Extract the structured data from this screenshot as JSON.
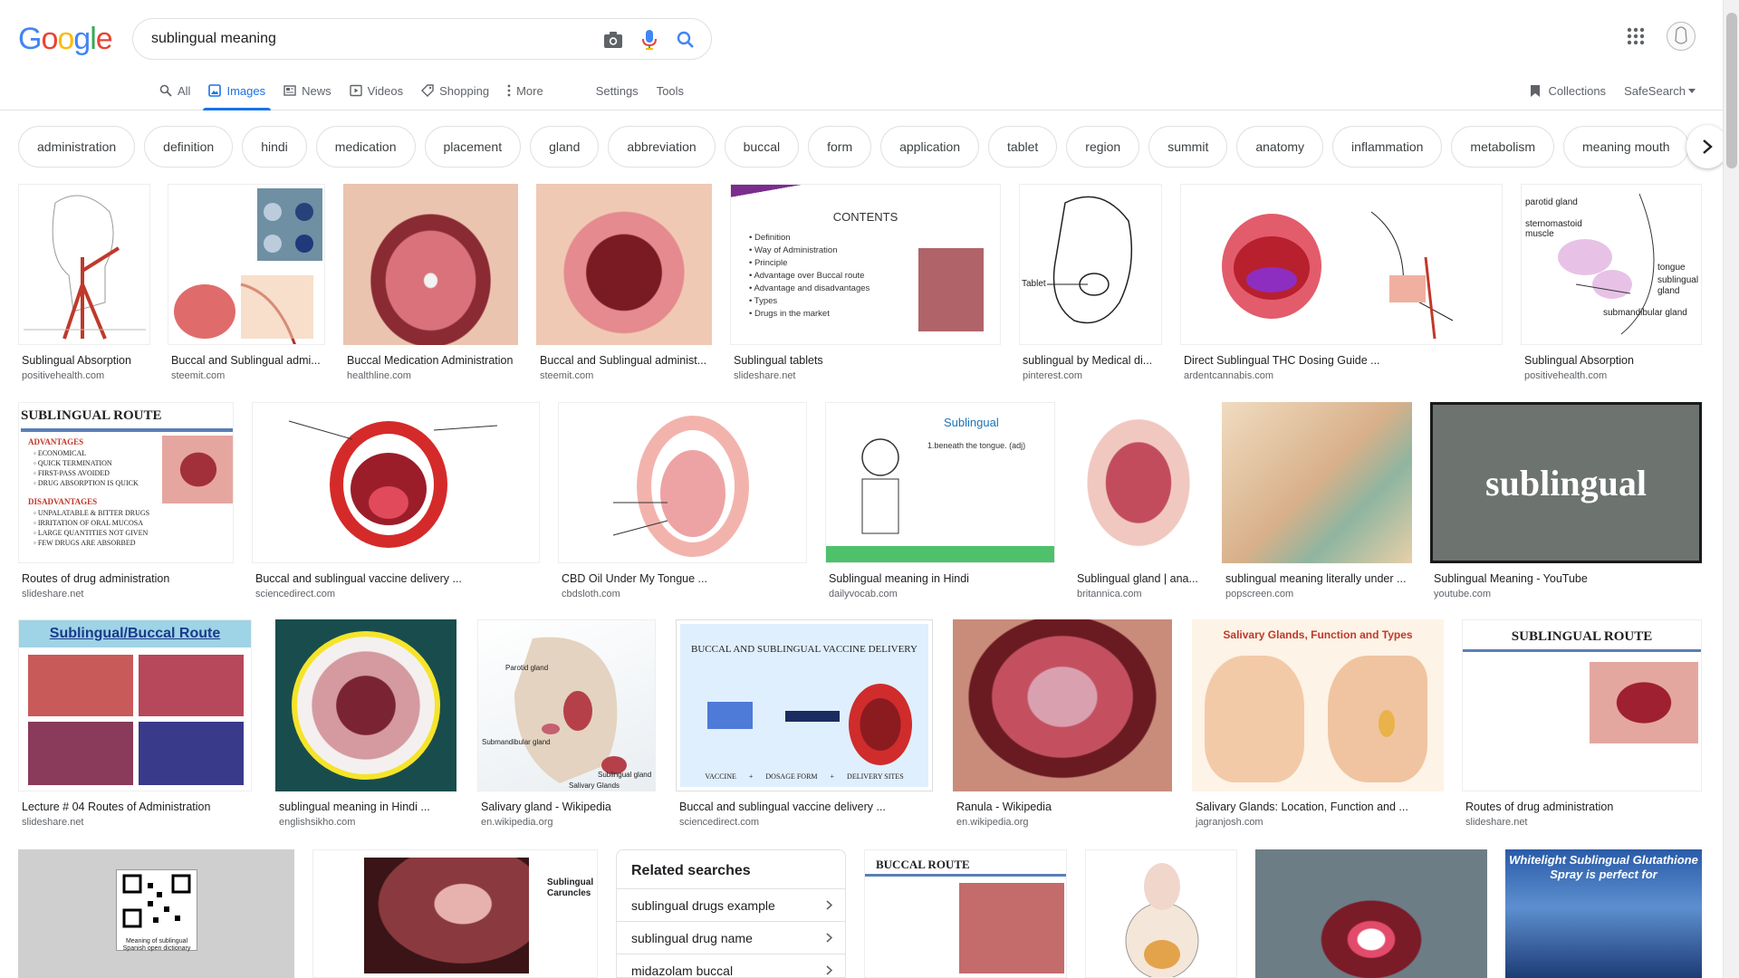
{
  "logo": {
    "letters": [
      "G",
      "o",
      "o",
      "g",
      "l",
      "e"
    ],
    "colors": [
      "#4285F4",
      "#EA4335",
      "#FBBC05",
      "#4285F4",
      "#34A853",
      "#EA4335"
    ]
  },
  "search": {
    "value": "sublingual meaning",
    "icons": [
      "camera-icon",
      "mic-icon",
      "search-icon"
    ]
  },
  "tabs": [
    {
      "label": "All",
      "icon": "search-icon"
    },
    {
      "label": "Images",
      "icon": "image-icon",
      "active": true
    },
    {
      "label": "News",
      "icon": "news-icon"
    },
    {
      "label": "Videos",
      "icon": "video-icon"
    },
    {
      "label": "Shopping",
      "icon": "tag-icon"
    },
    {
      "label": "More",
      "icon": "dots-vertical-icon"
    }
  ],
  "tools": {
    "settings": "Settings",
    "tools": "Tools"
  },
  "right_tools": {
    "collections": "Collections",
    "safesearch": "SafeSearch"
  },
  "chips": [
    "administration",
    "definition",
    "hindi",
    "medication",
    "placement",
    "gland",
    "abbreviation",
    "buccal",
    "form",
    "application",
    "tablet",
    "region",
    "summit",
    "anatomy",
    "inflammation",
    "metabolism",
    "meaning mouth"
  ],
  "results": {
    "row1": [
      {
        "caption": "Sublingual Absorption",
        "source": "positivehealth.com"
      },
      {
        "caption": "Buccal and Sublingual admi...",
        "source": "steemit.com"
      },
      {
        "caption": "Buccal Medication Administration",
        "source": "healthline.com"
      },
      {
        "caption": "Buccal and Sublingual administ...",
        "source": "steemit.com"
      },
      {
        "caption": "Sublingual tablets",
        "source": "slideshare.net",
        "img_title": "CONTENTS",
        "img_list": [
          "Definition",
          "Way of Administration",
          "Principle",
          "Advantage over Buccal route",
          "Advantage and disadvantages",
          "Types",
          "Drugs in the market"
        ]
      },
      {
        "caption": "sublingual by Medical di...",
        "source": "pinterest.com",
        "img_label": "Tablet"
      },
      {
        "caption": "Direct Sublingual THC Dosing Guide ...",
        "source": "ardentcannabis.com"
      },
      {
        "caption": "Sublingual Absorption",
        "source": "positivehealth.com",
        "img_labels": [
          "parotid gland",
          "sternomastoid muscle",
          "tongue",
          "sublingual gland",
          "submandibular gland"
        ]
      }
    ],
    "row2": [
      {
        "caption": "Routes of drug administration",
        "source": "slideshare.net",
        "img_title": "SUBLINGUAL ROUTE",
        "img_adv": "ADVANTAGES",
        "img_adv_list": [
          "ECONOMICAL",
          "QUICK TERMINATION",
          "FIRST-PASS AVOIDED",
          "DRUG ABSORPTION IS QUICK"
        ],
        "img_dis": "DISADVANTAGES",
        "img_dis_list": [
          "UNPALATABLE & BITTER DRUGS",
          "IRRITATION OF ORAL MUCOSA",
          "LARGE QUANTITIES NOT GIVEN",
          "FEW DRUGS ARE ABSORBED"
        ]
      },
      {
        "caption": "Buccal and sublingual vaccine delivery ...",
        "source": "sciencedirect.com"
      },
      {
        "caption": "CBD Oil Under My Tongue ...",
        "source": "cbdsloth.com"
      },
      {
        "caption": "Sublingual meaning in Hindi",
        "source": "dailyvocab.com",
        "img_word": "Sublingual",
        "img_def": "1.beneath the tongue. (adj)"
      },
      {
        "caption": "Sublingual gland | ana...",
        "source": "britannica.com"
      },
      {
        "caption": "sublingual meaning literally under ...",
        "source": "popscreen.com"
      },
      {
        "caption": "Sublingual Meaning - YouTube",
        "source": "youtube.com",
        "img_word": "sublingual"
      }
    ],
    "row3": [
      {
        "caption": "Lecture # 04 Routes of Administration",
        "source": "slideshare.net",
        "img_title": "Sublingual/Buccal Route"
      },
      {
        "caption": "sublingual meaning in Hindi ...",
        "source": "englishsikho.com"
      },
      {
        "caption": "Salivary gland - Wikipedia",
        "source": "en.wikipedia.org",
        "img_labels": [
          "Parotid gland",
          "Submandibular gland",
          "Sublingual gland",
          "Salivary Glands"
        ]
      },
      {
        "caption": "Buccal and sublingual vaccine delivery ...",
        "source": "sciencedirect.com",
        "img_title": "BUCCAL AND SUBLINGUAL VACCINE DELIVERY",
        "img_footer": [
          "VACCINE",
          "+",
          "DOSAGE FORM",
          "+",
          "DELIVERY SITES"
        ]
      },
      {
        "caption": "Ranula - Wikipedia",
        "source": "en.wikipedia.org"
      },
      {
        "caption": "Salivary Glands: Location, Function and ...",
        "source": "jagranjosh.com",
        "img_title": "Salivary Glands, Function and Types"
      },
      {
        "caption": "Routes of drug administration",
        "source": "slideshare.net",
        "img_title": "SUBLINGUAL ROUTE"
      }
    ],
    "row4": [
      {
        "img_text": "Meaning of sublingual Spanish open dictionary"
      },
      {
        "img_labels": [
          "Sublingual Caruncles"
        ]
      },
      {
        "img_title": "BUCCAL ROUTE"
      },
      {},
      {},
      {
        "img_title": "Whitelight Sublingual Glutathione Spray is perfect for"
      }
    ]
  },
  "related": {
    "title": "Related searches",
    "items": [
      "sublingual drugs example",
      "sublingual drug name",
      "midazolam buccal"
    ]
  }
}
